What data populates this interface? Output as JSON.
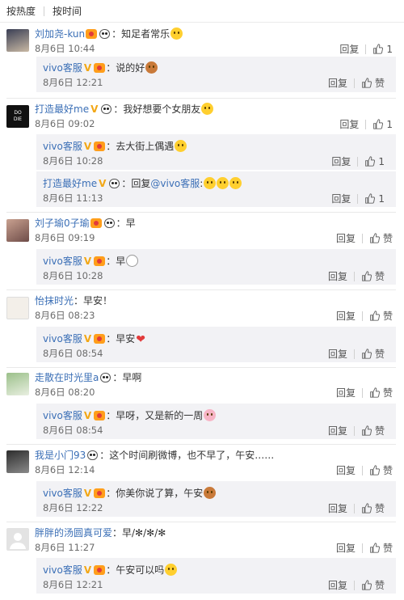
{
  "sort": {
    "hot_label": "按热度",
    "time_label": "按时间"
  },
  "actions": {
    "reply_label": "回复",
    "like_label": "赞"
  },
  "comments": [
    {
      "user": "刘加尧-kun",
      "text": "：知足者常乐",
      "time": "8月6日 10:44",
      "like_count": "1",
      "reply": {
        "user": "vivo客服",
        "text": "：说的好",
        "time": "8月6日 12:21"
      }
    },
    {
      "user": "打造最好me",
      "text": "：我好想要个女朋友",
      "time": "8月6日 09:02",
      "like_count": "1",
      "replies": [
        {
          "user": "vivo客服",
          "text": "：去大街上偶遇",
          "time": "8月6日 10:28",
          "like_count": "1"
        },
        {
          "user": "打造最好me",
          "text": "：回复",
          "mention": "@vivo客服",
          "text2": ":",
          "time": "8月6日 11:13",
          "like_count": "1"
        }
      ]
    },
    {
      "user": "刘子瑜0子瑜",
      "text": "：早",
      "time": "8月6日 09:19",
      "reply": {
        "user": "vivo客服",
        "text": "：早",
        "time": "8月6日 10:28"
      }
    },
    {
      "user": "怡抹时光",
      "text": "：早安！",
      "time": "8月6日 08:23",
      "reply": {
        "user": "vivo客服",
        "text": "：早安",
        "time": "8月6日 08:54"
      }
    },
    {
      "user": "走散在时光里a",
      "text": "：早啊",
      "time": "8月6日 08:20",
      "reply": {
        "user": "vivo客服",
        "text": "：早呀，又是新的一周",
        "time": "8月6日 08:54"
      }
    },
    {
      "user": "我是小门93",
      "text": "：这个时间刷微博，也不早了，午安……",
      "time": "8月6日 12:14",
      "reply": {
        "user": "vivo客服",
        "text": "：你美你说了算，午安",
        "time": "8月6日 12:22"
      }
    },
    {
      "user": "胖胖的汤圆真可爱",
      "text": "：早/✻/✻/✻",
      "time": "8月6日 11:27",
      "reply": {
        "user": "vivo客服",
        "text": "：午安可以吗",
        "time": "8月6日 12:21"
      }
    }
  ]
}
